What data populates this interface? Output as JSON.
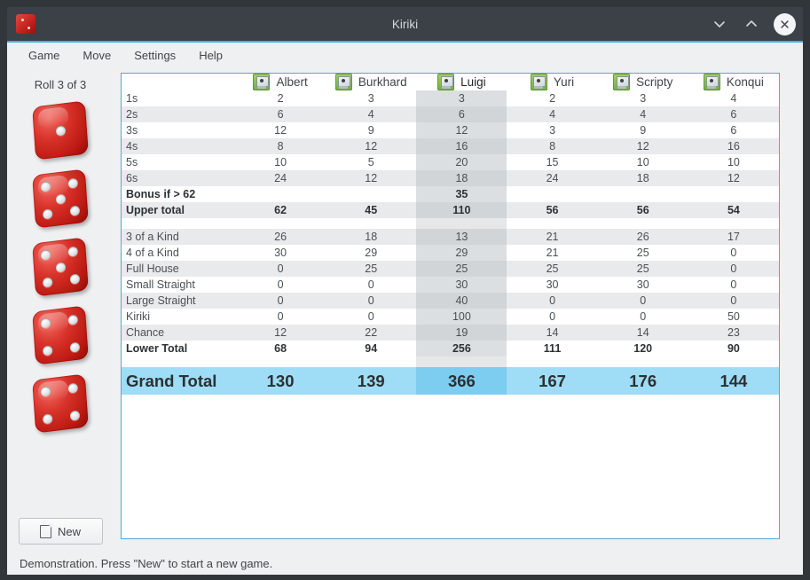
{
  "window": {
    "title": "Kiriki",
    "app_icon": "dice-icon",
    "controls": [
      {
        "name": "minimize-button",
        "icon": "chevron-down-icon"
      },
      {
        "name": "maximize-button",
        "icon": "chevron-up-icon"
      },
      {
        "name": "close-button",
        "icon": "close-icon"
      }
    ],
    "accent_color": "#3daee9"
  },
  "menubar": {
    "items": [
      {
        "label": "Game"
      },
      {
        "label": "Move"
      },
      {
        "label": "Settings"
      },
      {
        "label": "Help"
      }
    ]
  },
  "left_panel": {
    "roll_label": "Roll 3 of 3",
    "dice": [
      {
        "value": 1
      },
      {
        "value": 5
      },
      {
        "value": 5
      },
      {
        "value": 4
      },
      {
        "value": 4
      }
    ],
    "new_button": {
      "label": "New",
      "icon": "document-icon"
    }
  },
  "scoreboard": {
    "players": [
      {
        "name": "Albert",
        "icon": "computer-player-icon",
        "highlighted": false
      },
      {
        "name": "Burkhard",
        "icon": "computer-player-icon",
        "highlighted": false
      },
      {
        "name": "Luigi",
        "icon": "computer-player-icon",
        "highlighted": true
      },
      {
        "name": "Yuri",
        "icon": "computer-player-icon",
        "highlighted": false
      },
      {
        "name": "Scripty",
        "icon": "computer-player-icon",
        "highlighted": false
      },
      {
        "name": "Konqui",
        "icon": "computer-player-icon",
        "highlighted": false
      }
    ],
    "highlighted_column_index": 2,
    "rows": [
      {
        "label": "1s",
        "values": [
          "2",
          "3",
          "3",
          "2",
          "3",
          "4"
        ],
        "style": "normal"
      },
      {
        "label": "2s",
        "values": [
          "6",
          "4",
          "6",
          "4",
          "4",
          "6"
        ],
        "style": "normal"
      },
      {
        "label": "3s",
        "values": [
          "12",
          "9",
          "12",
          "3",
          "9",
          "6"
        ],
        "style": "normal"
      },
      {
        "label": "4s",
        "values": [
          "8",
          "12",
          "16",
          "8",
          "12",
          "16"
        ],
        "style": "normal"
      },
      {
        "label": "5s",
        "values": [
          "10",
          "5",
          "20",
          "15",
          "10",
          "10"
        ],
        "style": "normal"
      },
      {
        "label": "6s",
        "values": [
          "24",
          "12",
          "18",
          "24",
          "18",
          "12"
        ],
        "style": "normal"
      },
      {
        "label": "Bonus if > 62",
        "values": [
          "",
          "",
          "35",
          "",
          "",
          ""
        ],
        "style": "total"
      },
      {
        "label": "Upper total",
        "values": [
          "62",
          "45",
          "110",
          "56",
          "56",
          "54"
        ],
        "style": "total"
      },
      {
        "label": "",
        "values": [
          "",
          "",
          "",
          "",
          "",
          ""
        ],
        "style": "spacer"
      },
      {
        "label": "3 of a Kind",
        "values": [
          "26",
          "18",
          "13",
          "21",
          "26",
          "17"
        ],
        "style": "normal"
      },
      {
        "label": "4 of a Kind",
        "values": [
          "30",
          "29",
          "29",
          "21",
          "25",
          "0"
        ],
        "style": "normal"
      },
      {
        "label": "Full House",
        "values": [
          "0",
          "25",
          "25",
          "25",
          "25",
          "0"
        ],
        "style": "normal"
      },
      {
        "label": "Small Straight",
        "values": [
          "0",
          "0",
          "30",
          "30",
          "30",
          "0"
        ],
        "style": "normal"
      },
      {
        "label": "Large Straight",
        "values": [
          "0",
          "0",
          "40",
          "0",
          "0",
          "0"
        ],
        "style": "normal"
      },
      {
        "label": "Kiriki",
        "values": [
          "0",
          "0",
          "100",
          "0",
          "0",
          "50"
        ],
        "style": "normal"
      },
      {
        "label": "Chance",
        "values": [
          "12",
          "22",
          "19",
          "14",
          "14",
          "23"
        ],
        "style": "normal"
      },
      {
        "label": "Lower Total",
        "values": [
          "68",
          "94",
          "256",
          "111",
          "120",
          "90"
        ],
        "style": "total"
      },
      {
        "label": "",
        "values": [
          "",
          "",
          "",
          "",
          "",
          ""
        ],
        "style": "spacer"
      },
      {
        "label": "Grand Total",
        "values": [
          "130",
          "139",
          "366",
          "167",
          "176",
          "144"
        ],
        "style": "grand"
      }
    ],
    "grand_total_color": "#9fdcf5"
  },
  "statusbar": {
    "message": "Demonstration. Press \"New\" to start a new game."
  }
}
